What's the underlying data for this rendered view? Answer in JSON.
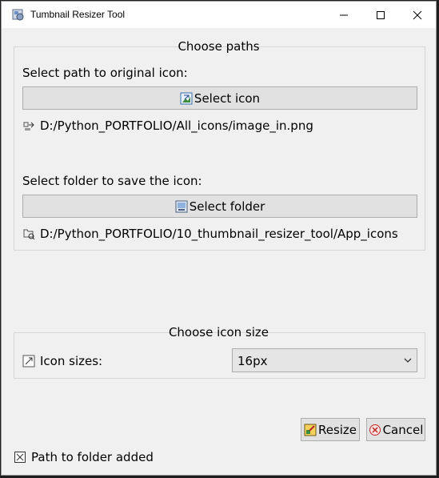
{
  "window": {
    "title": "Tumbnail Resizer Tool"
  },
  "paths_group": {
    "title": "Choose paths",
    "icon_label": "Select path to original icon:",
    "select_icon_button": "Select icon",
    "icon_path": "D:/Python_PORTFOLIO/All_icons/image_in.png",
    "folder_label": "Select folder to save the icon:",
    "select_folder_button": "Select folder",
    "folder_path": "D:/Python_PORTFOLIO/10_thumbnail_resizer_tool/App_icons"
  },
  "size_group": {
    "title": "Choose icon size",
    "sizes_label": "Icon sizes:",
    "selected_size": "16px"
  },
  "actions": {
    "resize": "Resize",
    "cancel": "Cancel"
  },
  "status": {
    "text": "Path to folder added"
  }
}
